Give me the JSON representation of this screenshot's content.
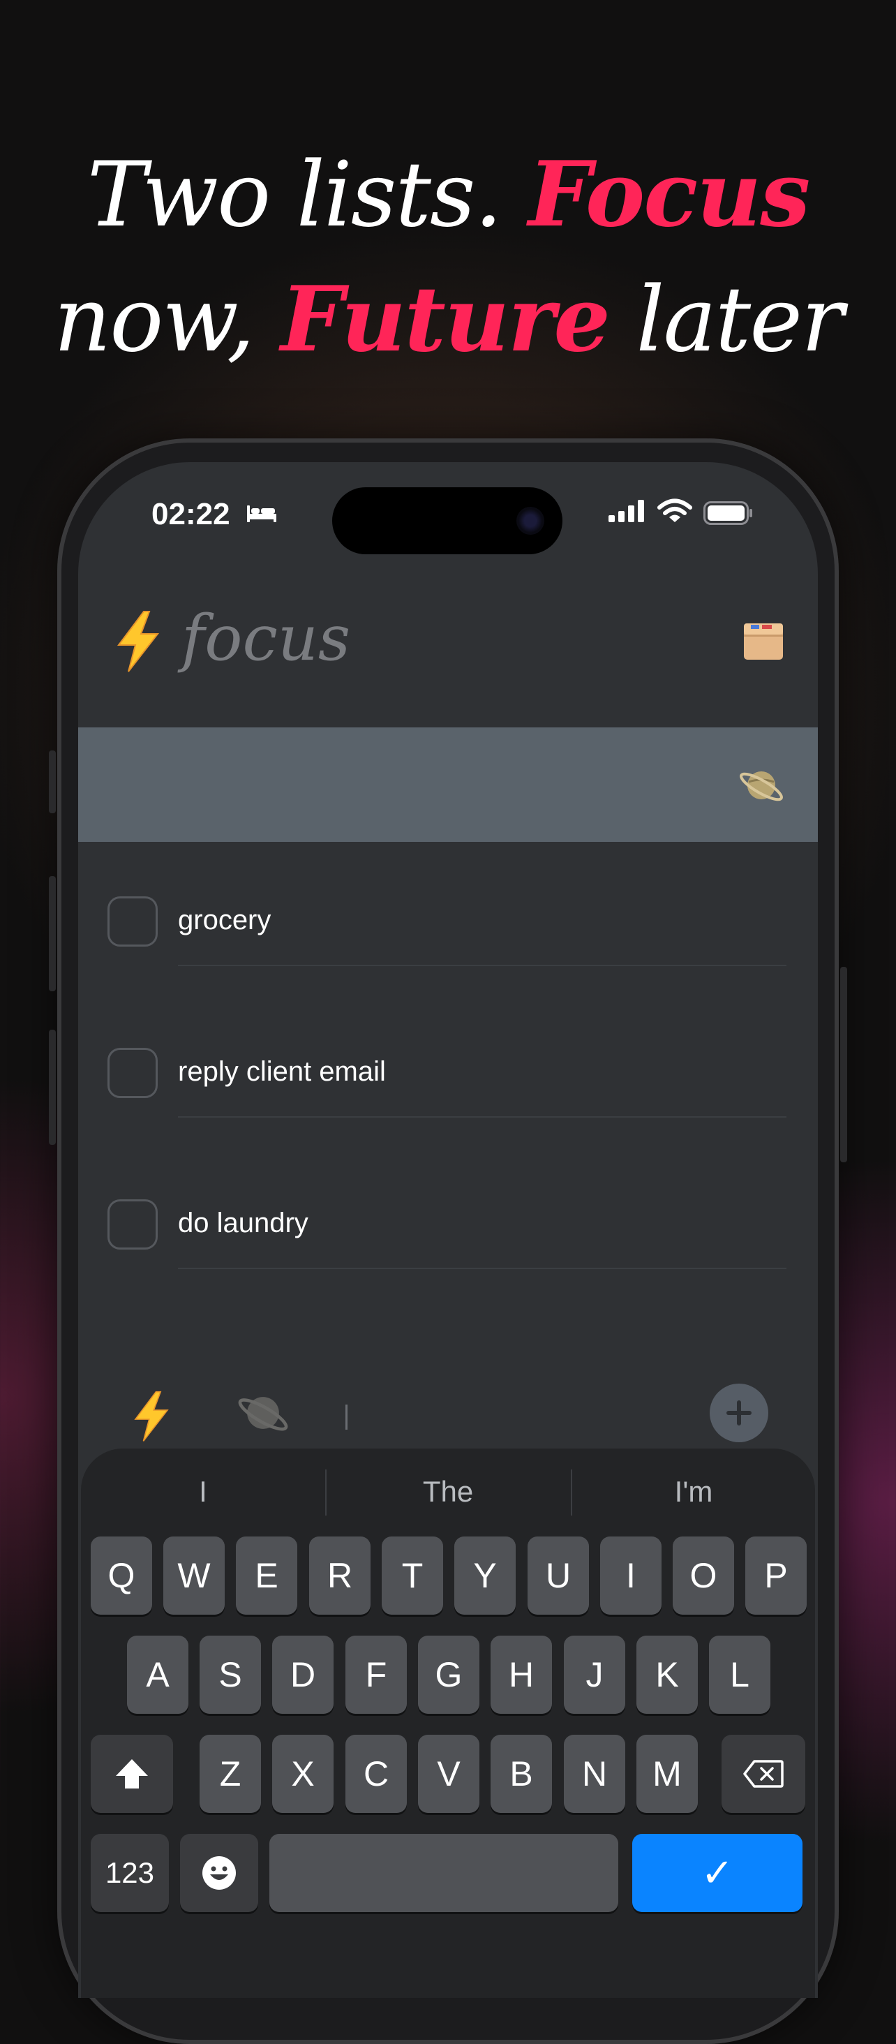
{
  "headline": {
    "line1_plain": "Two lists. ",
    "line1_accent": "Focus",
    "line2_plain_start": "now, ",
    "line2_accent": "Future",
    "line2_plain_end": " later"
  },
  "status_bar": {
    "time": "02:22",
    "icons": [
      "sleep-bed-icon",
      "cellular-signal-icon",
      "wifi-icon",
      "battery-icon"
    ]
  },
  "header": {
    "title": "focus",
    "bolt_icon": "lightning-bolt-icon",
    "box_icon": "package-box-icon"
  },
  "future_bar": {
    "icon": "ringed-planet-icon"
  },
  "tasks": [
    {
      "label": "grocery",
      "done": false
    },
    {
      "label": "reply client email",
      "done": false
    },
    {
      "label": "do laundry",
      "done": false
    }
  ],
  "composer": {
    "value": "",
    "icons": [
      "lightning-bolt-icon",
      "ringed-planet-icon",
      "plus-icon"
    ]
  },
  "keyboard": {
    "suggestions": [
      "I",
      "The",
      "I'm"
    ],
    "row1": [
      "Q",
      "W",
      "E",
      "R",
      "T",
      "Y",
      "U",
      "I",
      "O",
      "P"
    ],
    "row2": [
      "A",
      "S",
      "D",
      "F",
      "G",
      "H",
      "J",
      "K",
      "L"
    ],
    "row3": [
      "Z",
      "X",
      "C",
      "V",
      "B",
      "N",
      "M"
    ],
    "numbers_key": "123",
    "return_key": "✓"
  },
  "colors": {
    "accent": "#ff2558",
    "return_key": "#0a84ff",
    "future_bar": "#5a636b",
    "screen_bg": "#2f3134"
  }
}
